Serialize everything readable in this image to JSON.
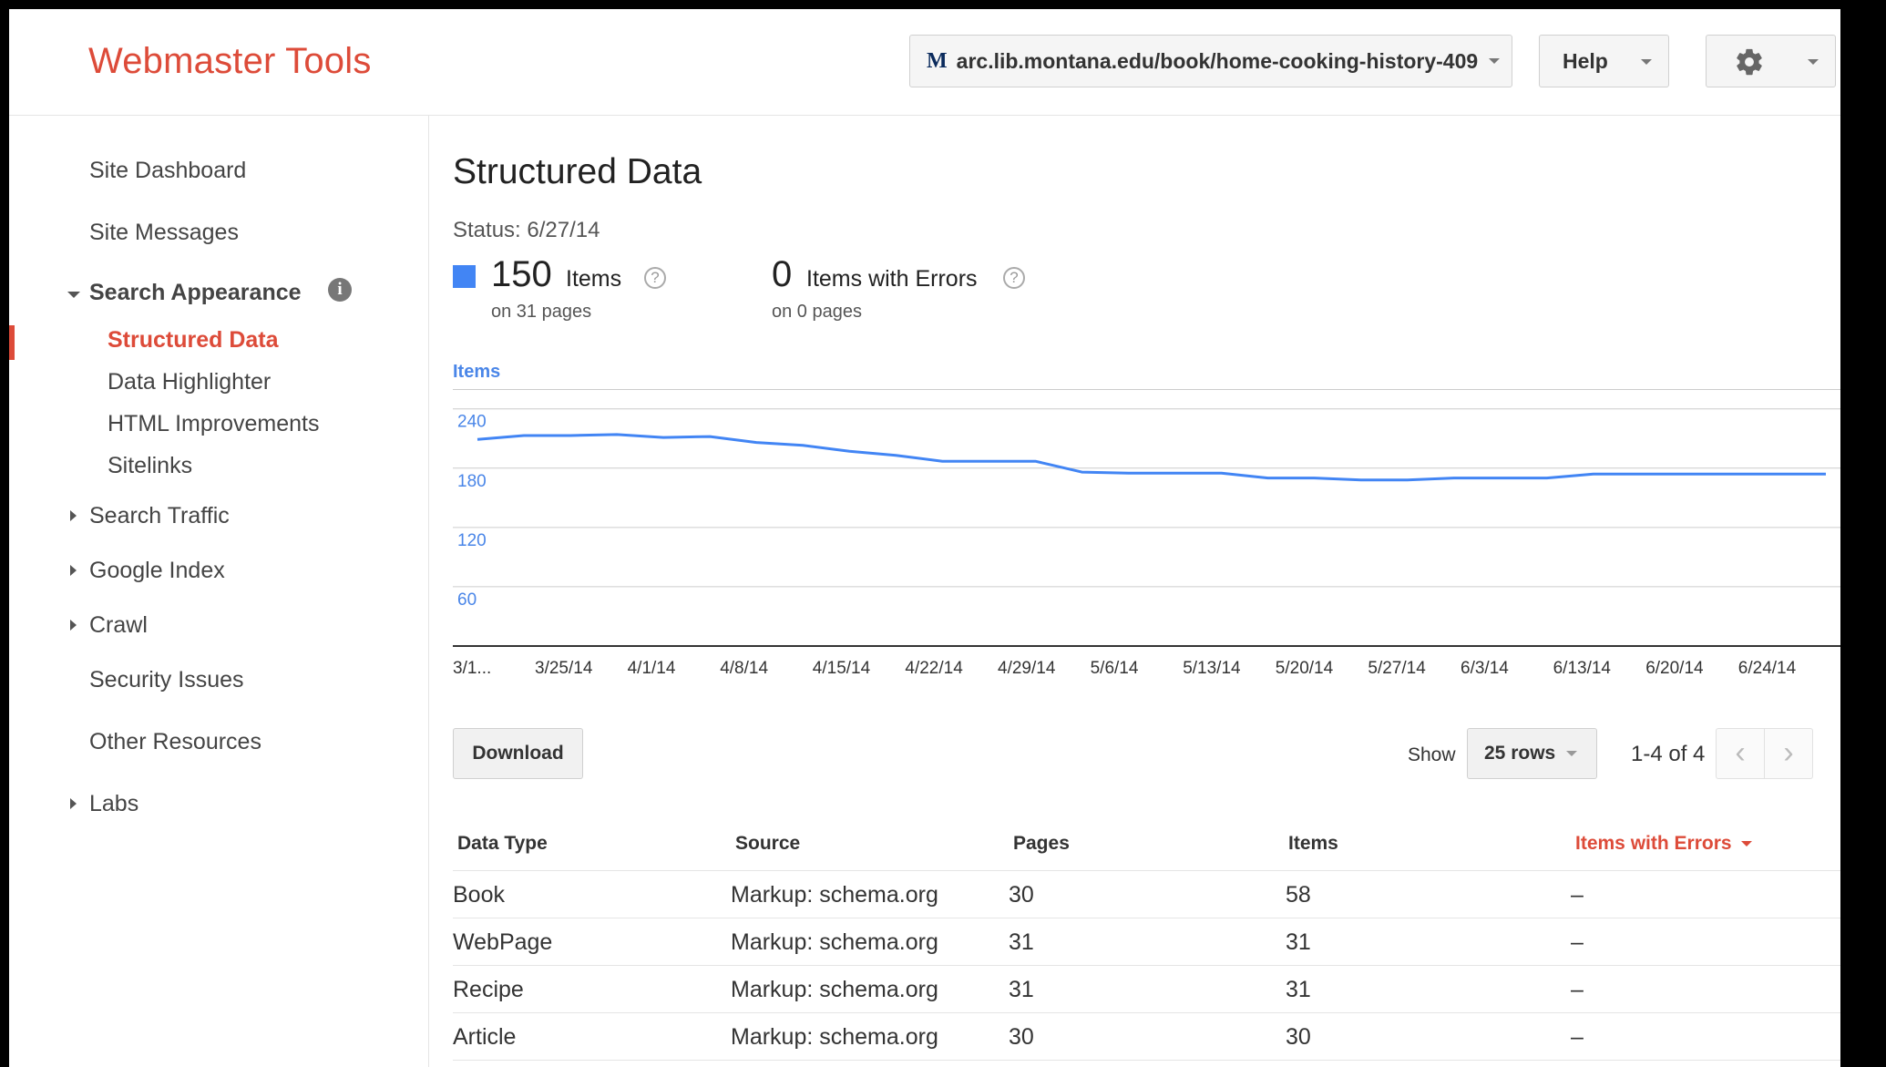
{
  "app": {
    "brand": "Webmaster Tools",
    "site_url": "arc.lib.montana.edu/book/home-cooking-history-409",
    "site_favicon": "M",
    "help_label": "Help",
    "accent": "#dd4b39",
    "series_color": "#4285f4"
  },
  "sidebar": {
    "site_dashboard": "Site Dashboard",
    "site_messages": "Site Messages",
    "search_appearance": "Search Appearance",
    "sub_items": [
      "Structured Data",
      "Data Highlighter",
      "HTML Improvements",
      "Sitelinks"
    ],
    "search_traffic": "Search Traffic",
    "google_index": "Google Index",
    "crawl": "Crawl",
    "security_issues": "Security Issues",
    "other_resources": "Other Resources",
    "labs": "Labs"
  },
  "main": {
    "title": "Structured Data",
    "status": "Status: 6/27/14",
    "items_count": "150",
    "items_label": "Items",
    "items_sub": "on 31 pages",
    "errors_count": "0",
    "errors_label": "Items with Errors",
    "errors_sub": "on 0 pages",
    "chart_legend": "Items",
    "download_label": "Download",
    "show_label": "Show",
    "rows_label": "25 rows",
    "pager_text": "1-4 of 4"
  },
  "chart_data": {
    "type": "line",
    "ylabel": "Items",
    "ylim": [
      0,
      260
    ],
    "yticks": [
      240,
      180,
      120,
      60
    ],
    "xtick_labels": [
      "3/1...",
      "3/25/14",
      "4/1/14",
      "4/8/14",
      "4/15/14",
      "4/22/14",
      "4/29/14",
      "5/6/14",
      "5/13/14",
      "5/20/14",
      "5/27/14",
      "6/3/14",
      "6/13/14",
      "6/20/14",
      "6/24/14"
    ],
    "grid": true,
    "series": [
      {
        "name": "Items",
        "values": [
          209,
          213,
          213,
          214,
          211,
          212,
          206,
          203,
          197,
          193,
          187,
          187,
          187,
          176,
          175,
          175,
          175,
          170,
          170,
          168,
          168,
          170,
          170,
          170,
          174,
          174,
          174,
          174,
          174,
          174
        ]
      }
    ]
  },
  "table": {
    "headers": [
      "Data Type",
      "Source",
      "Pages",
      "Items",
      "Items with Errors"
    ],
    "rows": [
      [
        "Book",
        "Markup: schema.org",
        "30",
        "58",
        "–"
      ],
      [
        "WebPage",
        "Markup: schema.org",
        "31",
        "31",
        "–"
      ],
      [
        "Recipe",
        "Markup: schema.org",
        "31",
        "31",
        "–"
      ],
      [
        "Article",
        "Markup: schema.org",
        "30",
        "30",
        "–"
      ]
    ]
  }
}
